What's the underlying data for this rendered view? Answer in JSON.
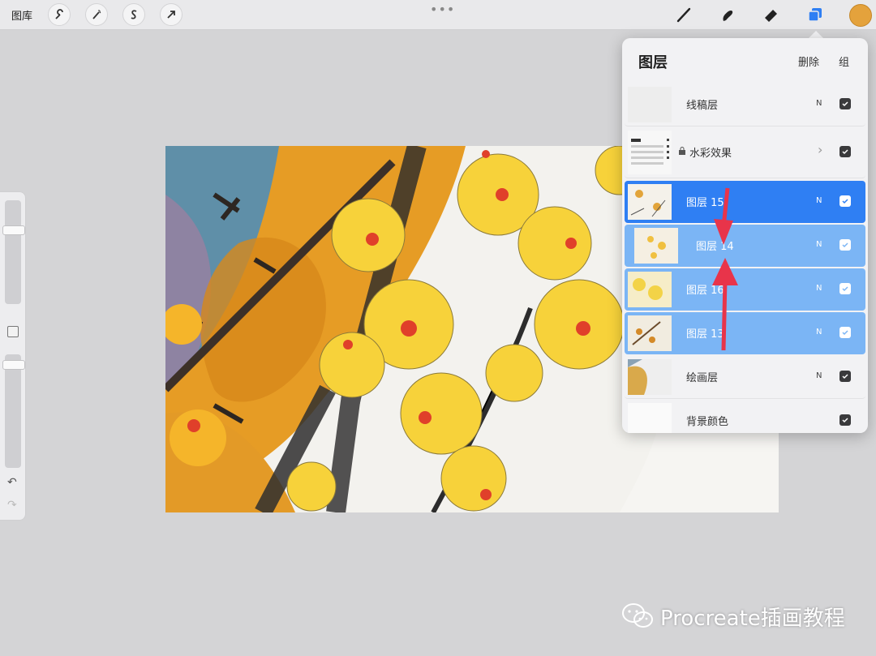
{
  "toolbar": {
    "gallery_label": "图库",
    "left_tools": [
      "wrench-icon",
      "magic-wand-icon",
      "selection-icon",
      "transform-arrow-icon"
    ],
    "right_tools": [
      "brush-icon",
      "smudge-icon",
      "eraser-icon",
      "layers-icon"
    ],
    "dots": "•••",
    "current_color": "#e4a23c"
  },
  "layers_panel": {
    "title": "图层",
    "delete_label": "删除",
    "group_label": "组",
    "layers": [
      {
        "name": "线稿层",
        "blend": "N",
        "state": "normal"
      },
      {
        "name": "水彩效果",
        "blend": "",
        "state": "group",
        "locked": true
      },
      {
        "name": "图层 15",
        "blend": "N",
        "state": "active"
      },
      {
        "name": "图层 14",
        "blend": "N",
        "state": "selected"
      },
      {
        "name": "图层 16",
        "blend": "N",
        "state": "selected"
      },
      {
        "name": "图层 13",
        "blend": "N",
        "state": "selected"
      },
      {
        "name": "绘画层",
        "blend": "N",
        "state": "normal"
      },
      {
        "name": "背景颜色",
        "blend": "",
        "state": "normal"
      }
    ]
  },
  "sidebar": {
    "brush_size_level": 0.12,
    "opacity_level": 0.05
  },
  "watermark": {
    "text": "Procreate插画教程"
  }
}
